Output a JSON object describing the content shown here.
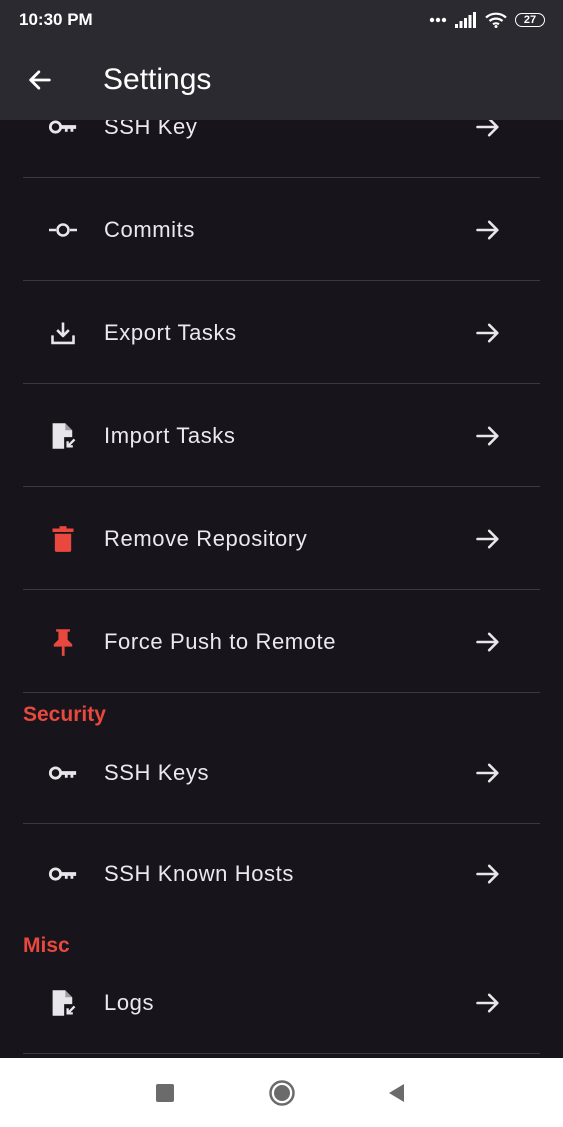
{
  "status_bar": {
    "time": "10:30 PM",
    "battery": "27",
    "icons": [
      "more-dots-icon",
      "signal-icon",
      "wifi-icon",
      "battery-icon"
    ]
  },
  "app_bar": {
    "title": "Settings",
    "back_icon": "arrow-left-icon"
  },
  "rows": [
    {
      "label": "SSH Key",
      "icon": "key-icon",
      "icon_color": "#e8e6ea"
    },
    {
      "label": "Commits",
      "icon": "commit-icon",
      "icon_color": "#e8e6ea"
    },
    {
      "label": "Export Tasks",
      "icon": "download-icon",
      "icon_color": "#e8e6ea"
    },
    {
      "label": "Import Tasks",
      "icon": "file-import-icon",
      "icon_color": "#e8e6ea"
    },
    {
      "label": "Remove Repository",
      "icon": "trash-icon",
      "icon_color": "#e8483d"
    },
    {
      "label": "Force Push to Remote",
      "icon": "pin-icon",
      "icon_color": "#e8483d"
    }
  ],
  "sections": [
    {
      "title": "Security",
      "rows": [
        {
          "label": "SSH Keys",
          "icon": "key-icon"
        },
        {
          "label": "SSH Known Hosts",
          "icon": "key-icon"
        }
      ]
    },
    {
      "title": "Misc",
      "rows": [
        {
          "label": "Logs",
          "icon": "file-import-icon"
        }
      ]
    }
  ],
  "nav_bar": {
    "icons": [
      "recents-square-icon",
      "home-circle-icon",
      "back-triangle-icon"
    ]
  },
  "colors": {
    "background": "#17151b",
    "app_bar": "#2c2a31",
    "accent_red": "#e8483d",
    "divider": "#3b3940",
    "text": "#ebe8ee"
  }
}
